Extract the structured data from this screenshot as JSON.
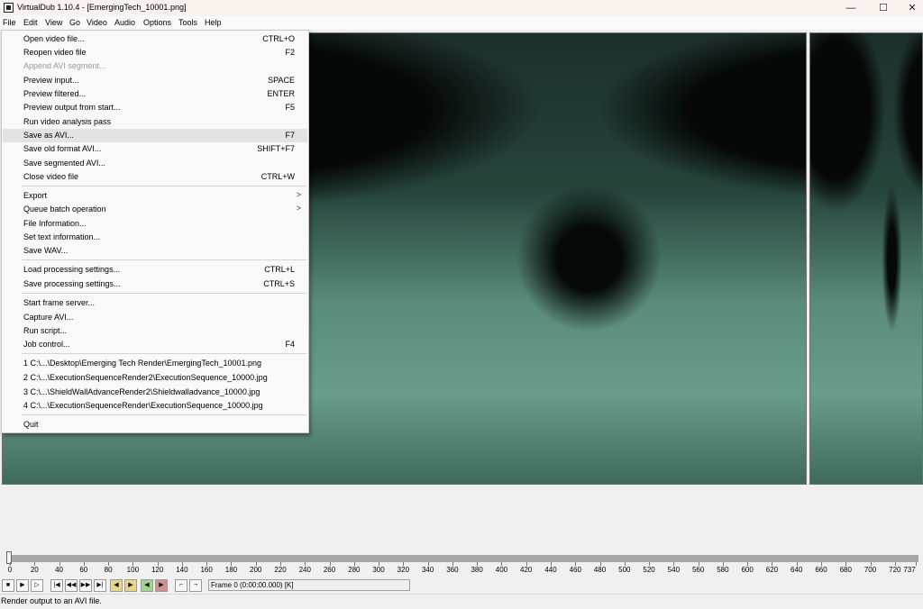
{
  "window": {
    "title": "VirtualDub 1.10.4 - [EmergingTech_10001.png]",
    "controls": {
      "minimize": "—",
      "maximize": "☐",
      "close": "✕"
    }
  },
  "menubar": [
    "File",
    "Edit",
    "View",
    "Go",
    "Video",
    "Audio",
    "Options",
    "Tools",
    "Help"
  ],
  "file_menu": {
    "items": {
      "open_video": {
        "label": "Open video file...",
        "accel": "CTRL+O"
      },
      "reopen_video": {
        "label": "Reopen video file",
        "accel": "F2"
      },
      "append_avi": {
        "label": "Append AVI segment...",
        "accel": ""
      },
      "preview_input": {
        "label": "Preview input...",
        "accel": "SPACE"
      },
      "preview_filtered": {
        "label": "Preview filtered...",
        "accel": "ENTER"
      },
      "preview_output": {
        "label": "Preview output from start...",
        "accel": "F5"
      },
      "run_analysis": {
        "label": "Run video analysis pass",
        "accel": ""
      },
      "save_avi": {
        "label": "Save as AVI...",
        "accel": "F7"
      },
      "save_old_avi": {
        "label": "Save old format AVI...",
        "accel": "SHIFT+F7"
      },
      "save_segmented": {
        "label": "Save segmented AVI...",
        "accel": ""
      },
      "close_video": {
        "label": "Close video file",
        "accel": "CTRL+W"
      },
      "export": {
        "label": "Export",
        "accel": ""
      },
      "queue_batch": {
        "label": "Queue batch operation",
        "accel": ""
      },
      "file_info": {
        "label": "File Information...",
        "accel": ""
      },
      "set_text_info": {
        "label": "Set text information...",
        "accel": ""
      },
      "save_wav": {
        "label": "Save WAV...",
        "accel": ""
      },
      "load_settings": {
        "label": "Load processing settings...",
        "accel": "CTRL+L"
      },
      "save_settings": {
        "label": "Save processing settings...",
        "accel": "CTRL+S"
      },
      "frame_server": {
        "label": "Start frame server...",
        "accel": ""
      },
      "capture_avi": {
        "label": "Capture AVI...",
        "accel": ""
      },
      "run_script": {
        "label": "Run script...",
        "accel": ""
      },
      "job_control": {
        "label": "Job control...",
        "accel": "F4"
      },
      "recent_1": {
        "label": "1 C:\\...\\Desktop\\Emerging Tech Render\\EmergingTech_10001.png",
        "accel": ""
      },
      "recent_2": {
        "label": "2 C:\\...\\ExecutionSequenceRender2\\ExecutionSequence_10000.jpg",
        "accel": ""
      },
      "recent_3": {
        "label": "3 C:\\...\\ShieldWallAdvanceRender2\\Shieldwalladvance_10000.jpg",
        "accel": ""
      },
      "recent_4": {
        "label": "4 C:\\...\\ExecutionSequenceRender\\ExecutionSequence_10000.jpg",
        "accel": ""
      },
      "quit": {
        "label": "Quit",
        "accel": ""
      }
    },
    "highlighted": "Save as AVI..."
  },
  "timeline": {
    "ticks": [
      "0",
      "20",
      "40",
      "60",
      "80",
      "100",
      "120",
      "140",
      "160",
      "180",
      "200",
      "220",
      "240",
      "260",
      "280",
      "300",
      "320",
      "340",
      "360",
      "380",
      "400",
      "420",
      "440",
      "460",
      "480",
      "500",
      "520",
      "540",
      "560",
      "580",
      "600",
      "620",
      "640",
      "660",
      "680",
      "700",
      "720",
      "737"
    ],
    "current_frame": 0,
    "total_frames": 737
  },
  "toolbar": {
    "buttons": [
      "stop-icon",
      "play-input-icon",
      "play-output-icon",
      "go-start-icon",
      "prev-key-icon",
      "next-key-icon",
      "go-end-icon",
      "key-prev-icon",
      "key-next-icon",
      "scene-prev-icon",
      "scene-next-icon",
      "mark-in-icon",
      "mark-out-icon"
    ],
    "frame_display": "Frame 0 (0:00:00.000) [K]"
  },
  "status": {
    "text": "Render output to an AVI file."
  }
}
